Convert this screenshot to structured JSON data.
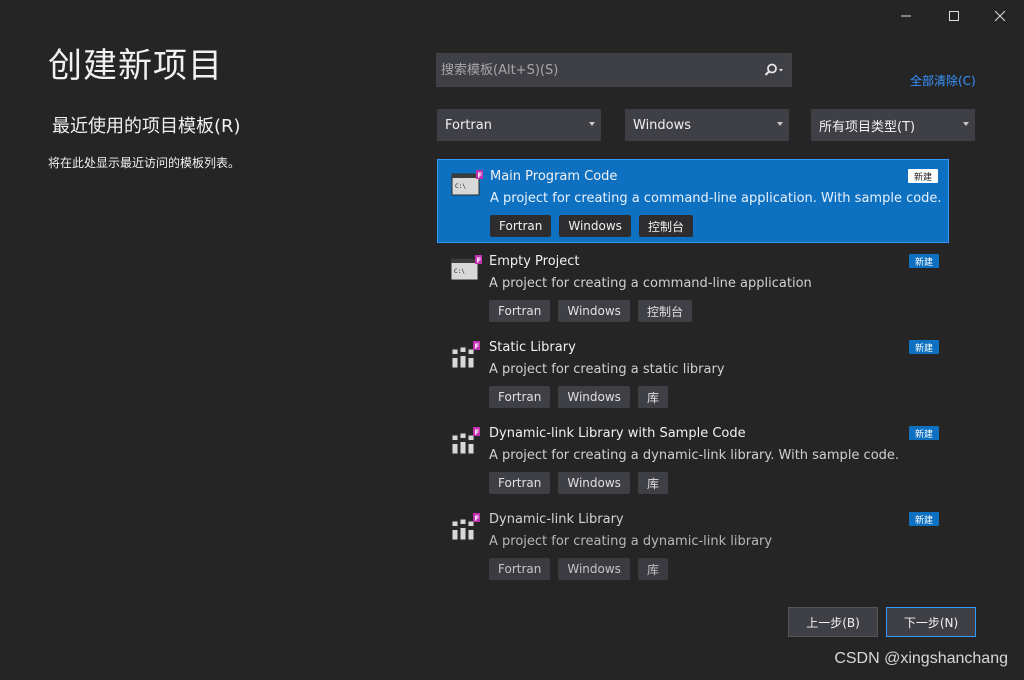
{
  "window": {
    "minimize_icon": "minimize-icon",
    "maximize_icon": "maximize-icon",
    "close_icon": "close-icon"
  },
  "page_title": "创建新项目",
  "recent": {
    "heading": "最近使用的项目模板(R)",
    "empty_text": "将在此处显示最近访问的模板列表。"
  },
  "search": {
    "placeholder": "搜索模板(Alt+S)(S)",
    "value": "",
    "icon": "search-icon"
  },
  "clear_all": "全部清除(C)",
  "filters": {
    "language": "Fortran",
    "platform": "Windows",
    "project_type": "所有项目类型(T)"
  },
  "templates": [
    {
      "name": "Main Program Code",
      "description": "A project for creating a command-line application. With sample code.",
      "tags": [
        "Fortran",
        "Windows",
        "控制台"
      ],
      "badge": "新建",
      "icon": "console-app-icon",
      "selected": true
    },
    {
      "name": "Empty Project",
      "description": "A project for creating a command-line application",
      "tags": [
        "Fortran",
        "Windows",
        "控制台"
      ],
      "badge": "新建",
      "icon": "console-app-icon",
      "selected": false
    },
    {
      "name": "Static Library",
      "description": "A project for creating a static library",
      "tags": [
        "Fortran",
        "Windows",
        "库"
      ],
      "badge": "新建",
      "icon": "library-icon",
      "selected": false
    },
    {
      "name": "Dynamic-link Library with Sample Code",
      "description": "A project for creating a dynamic-link library. With sample code.",
      "tags": [
        "Fortran",
        "Windows",
        "库"
      ],
      "badge": "新建",
      "icon": "library-icon",
      "selected": false
    },
    {
      "name": "Dynamic-link Library",
      "description": "A project for creating a dynamic-link library",
      "tags": [
        "Fortran",
        "Windows",
        "库"
      ],
      "badge": "新建",
      "icon": "library-icon",
      "selected": false
    }
  ],
  "buttons": {
    "back": "上一步(B)",
    "next": "下一步(N)"
  },
  "watermark": "CSDN @xingshanchang",
  "colors": {
    "background": "#252526",
    "selected": "#0e70c0",
    "accent_link": "#3794ff",
    "fortran_badge": "#e040c0"
  }
}
